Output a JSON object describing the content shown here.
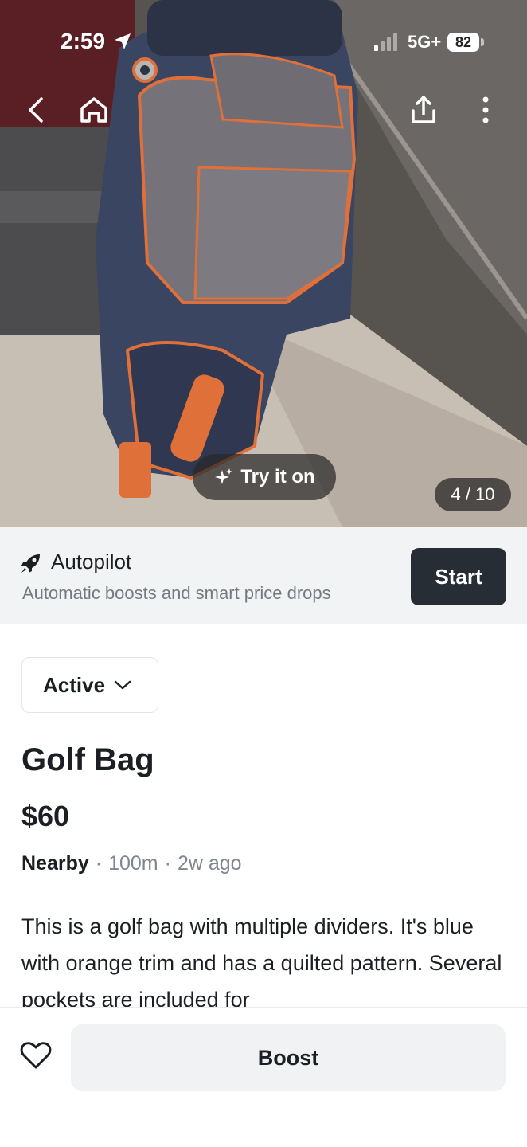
{
  "status_bar": {
    "time": "2:59",
    "network": "5G+",
    "battery": "82"
  },
  "photo": {
    "try_on_label": "Try it on",
    "counter": "4 / 10"
  },
  "autopilot": {
    "title": "Autopilot",
    "subtitle": "Automatic boosts and smart price drops",
    "start_label": "Start"
  },
  "listing": {
    "status": "Active",
    "title": "Golf Bag",
    "price": "$60",
    "location": "Nearby",
    "distance": "100m",
    "age": "2w ago",
    "description": "This is a golf bag with multiple dividers. It's blue with orange trim and has a quilted pattern. Several pockets are included for"
  },
  "bottom": {
    "boost_label": "Boost"
  },
  "colors": {
    "trim_orange": "#e0703a",
    "bag_navy": "#3c4a68",
    "button_dark": "#262d35"
  }
}
